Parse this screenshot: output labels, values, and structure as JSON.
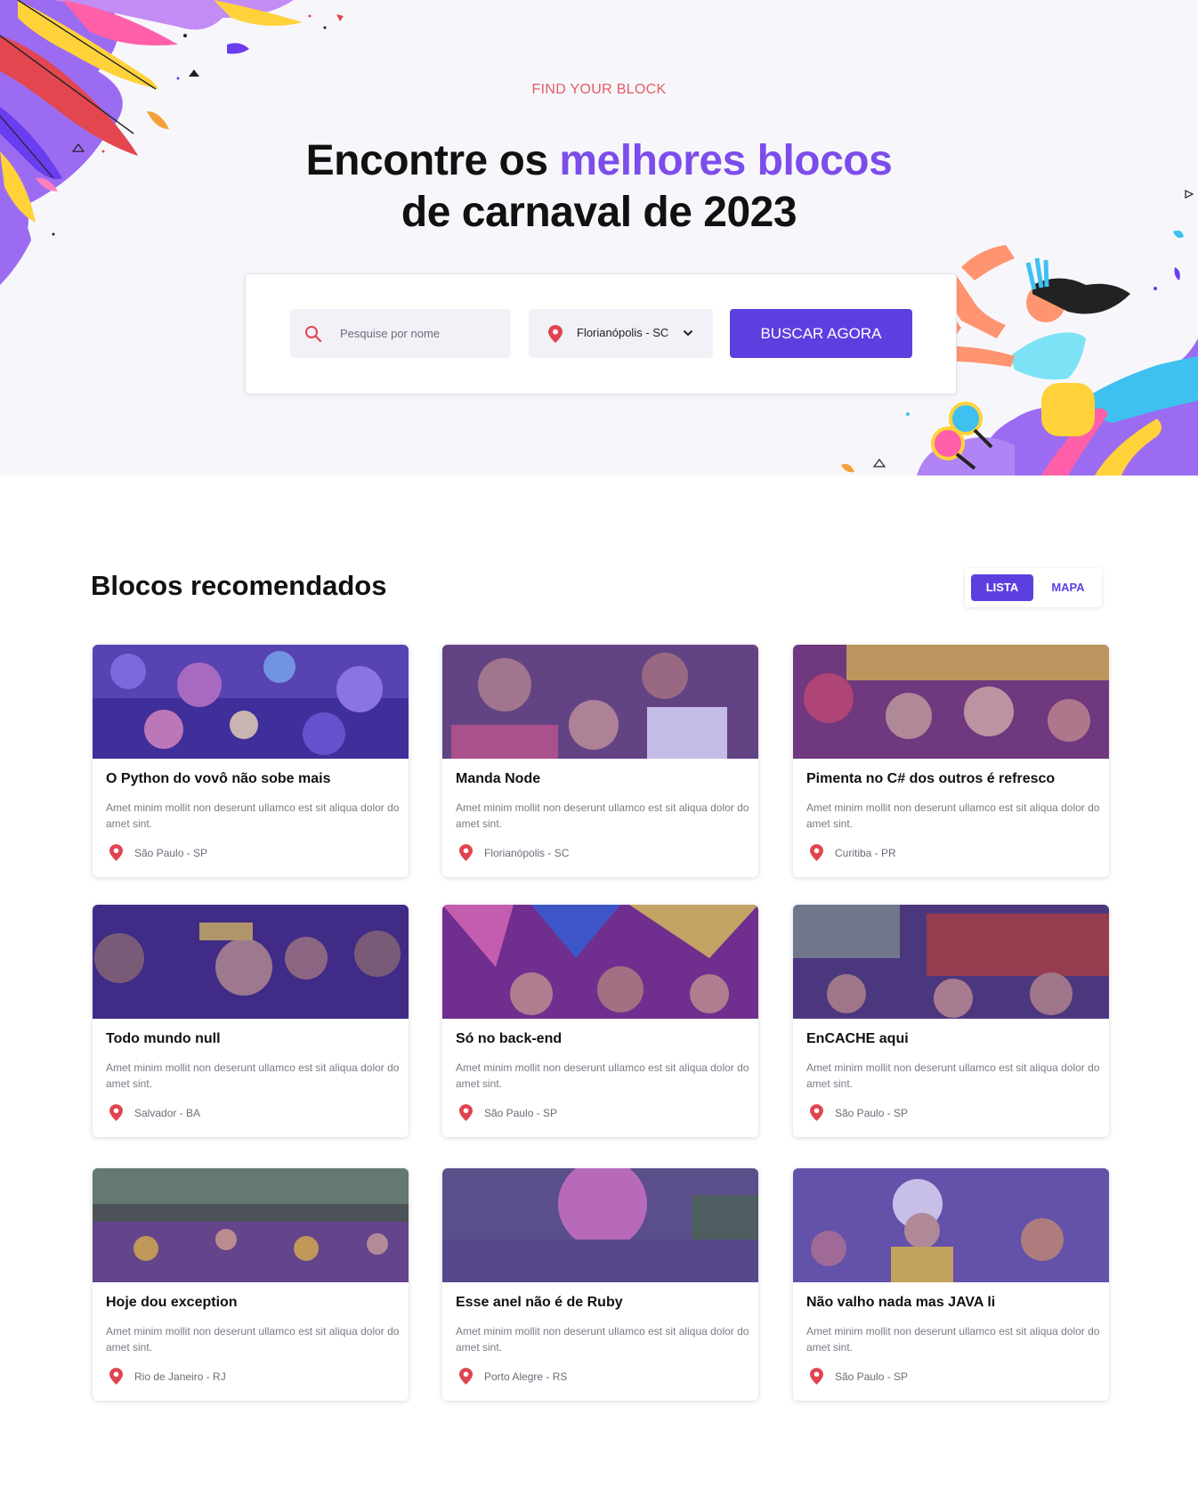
{
  "hero": {
    "eyebrow": "FIND YOUR BLOCK",
    "headline_part1": "Encontre os ",
    "headline_accent": "melhores blocos",
    "headline_part2": "de carnaval de 2023"
  },
  "search": {
    "placeholder": "Pesquise por nome",
    "city_value": "Florianópolis - SC",
    "button_label": "BUSCAR AGORA"
  },
  "section": {
    "title": "Blocos recomendados",
    "toggle_list": "LISTA",
    "toggle_map": "MAPA"
  },
  "colors": {
    "accent": "#5d3fe0",
    "headline_accent": "#7c4dea",
    "eyebrow": "#e45b63",
    "pin": "#e0454f"
  },
  "icons": {
    "search": "search-icon",
    "pin": "map-pin-icon",
    "chevron": "chevron-down-icon"
  },
  "cards": [
    {
      "title": "O Python do vovô não sobe mais",
      "description": "Amet minim mollit non deserunt ullamco est sit aliqua dolor do amet sint.",
      "location": "São Paulo - SP"
    },
    {
      "title": "Manda Node",
      "description": "Amet minim mollit non deserunt ullamco est sit aliqua dolor do amet sint.",
      "location": "Florianópolis - SC"
    },
    {
      "title": "Pimenta no C# dos outros é refresco",
      "description": "Amet minim mollit non deserunt ullamco est sit aliqua dolor do amet sint.",
      "location": "Curitiba - PR"
    },
    {
      "title": "Todo mundo null",
      "description": "Amet minim mollit non deserunt ullamco est sit aliqua dolor do amet sint.",
      "location": "Salvador - BA"
    },
    {
      "title": "Só no back-end",
      "description": "Amet minim mollit non deserunt ullamco est sit aliqua dolor do amet sint.",
      "location": "São Paulo - SP"
    },
    {
      "title": "EnCACHE aqui",
      "description": "Amet minim mollit non deserunt ullamco est sit aliqua dolor do amet sint.",
      "location": "São Paulo - SP"
    },
    {
      "title": "Hoje dou exception",
      "description": "Amet minim mollit non deserunt ullamco est sit aliqua dolor do amet sint.",
      "location": "Rio de Janeiro - RJ"
    },
    {
      "title": "Esse anel não é de Ruby",
      "description": "Amet minim mollit non deserunt ullamco est sit aliqua dolor do amet sint.",
      "location": "Porto Alegre - RS"
    },
    {
      "title": "Não valho nada mas JAVA li",
      "description": "Amet minim mollit non deserunt ullamco est sit aliqua dolor do amet sint.",
      "location": "São Paulo - SP"
    }
  ]
}
